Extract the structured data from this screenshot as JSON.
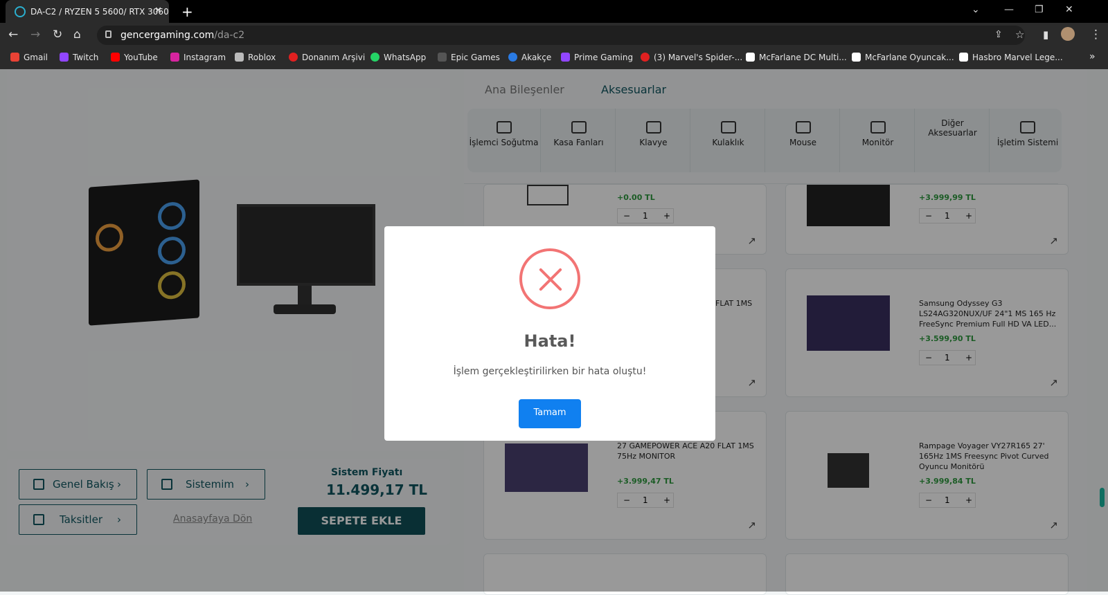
{
  "browser": {
    "tab_title": "DA-C2 / RYZEN 5 5600/ RTX 3060",
    "url_host": "gencergaming.com",
    "url_path": "/da-c2",
    "bookmarks": [
      "Gmail",
      "Twitch",
      "YouTube",
      "Instagram",
      "Roblox",
      "Donanım Arşivi",
      "WhatsApp",
      "Epic Games",
      "Akakçe",
      "Prime Gaming",
      "(3) Marvel's Spider-...",
      "McFarlane DC Multi...",
      "McFarlane Oyuncak...",
      "Hasbro Marvel Lege..."
    ]
  },
  "right": {
    "tabs": [
      "Ana Bileşenler",
      "Aksesuarlar"
    ],
    "categories": [
      "İşlemci Soğutma",
      "Kasa Fanları",
      "Klavye",
      "Kulaklık",
      "Mouse",
      "Monitör",
      "Diğer Aksesuarlar",
      "İşletim Sistemi"
    ],
    "products": [
      {
        "title": "",
        "price": "+0.00 TL",
        "qty": "1"
      },
      {
        "title": "",
        "price": "+3.999,99 TL",
        "qty": "1"
      },
      {
        "title": "FLAT 1MS",
        "price": "",
        "qty": ""
      },
      {
        "title": "Samsung Odyssey G3 LS24AG320NUX/UF 24\"1 MS 165 Hz FreeSync Premium Full HD VA LED...",
        "price": "+3.599,90 TL",
        "qty": "1"
      },
      {
        "title": "27 GAMEPOWER ACE A20 FLAT 1MS 75Hz MONITOR",
        "price": "+3.999,47 TL",
        "qty": "1"
      },
      {
        "title": "Rampage Voyager VY27R165 27' 165Hz 1MS Freesync Pivot Curved Oyuncu Monitörü",
        "price": "+3.999,84 TL",
        "qty": "1"
      }
    ]
  },
  "left": {
    "btn_overview": "Genel Bakış",
    "btn_system": "Sistemim",
    "btn_installments": "Taksitler",
    "home_link": "Anasayfaya Dön",
    "price_label": "Sistem Fiyatı",
    "price": "11.499,17  TL",
    "cart_button": "SEPETE EKLE"
  },
  "modal": {
    "title": "Hata!",
    "message": "İşlem gerçekleştirilirken bir hata oluştu!",
    "button": "Tamam"
  }
}
